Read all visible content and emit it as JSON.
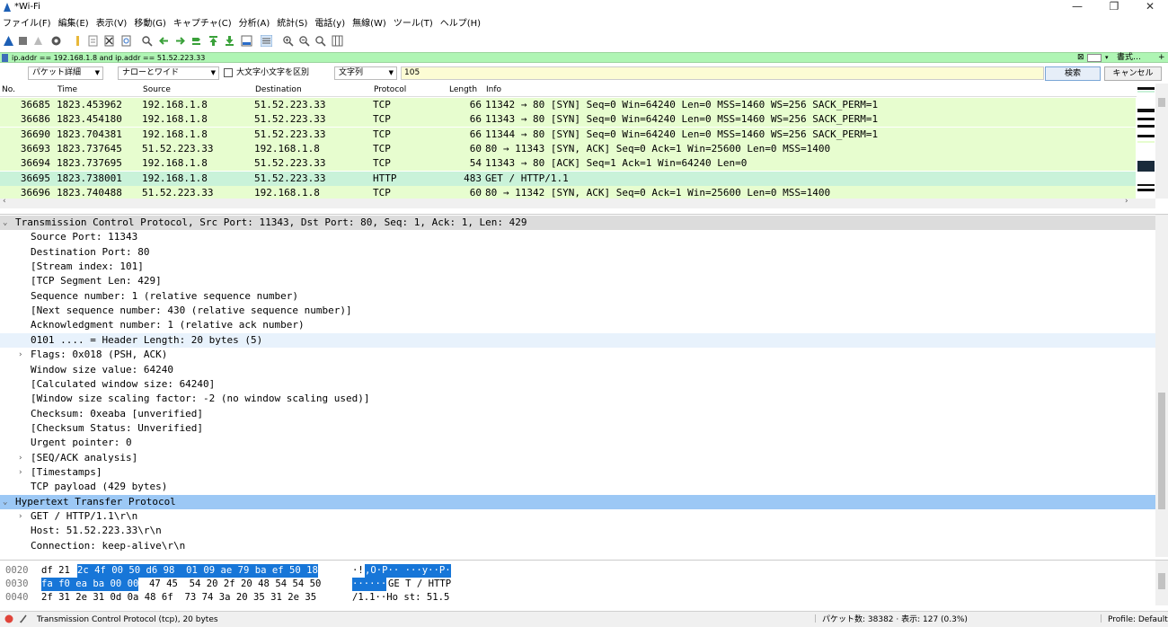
{
  "window": {
    "title": "*Wi-Fi"
  },
  "menu": [
    "ファイル(F)",
    "編集(E)",
    "表示(V)",
    "移動(G)",
    "キャプチャ(C)",
    "分析(A)",
    "統計(S)",
    "電話(y)",
    "無線(W)",
    "ツール(T)",
    "ヘルプ(H)"
  ],
  "filter": {
    "text": "ip.addr == 192.168.1.8 and ip.addr == 51.52.223.33",
    "expression_label": "書式…",
    "add_label": "+"
  },
  "search": {
    "scope": "パケット詳細",
    "width": "ナローとワイド",
    "case_label": "大文字小文字を区別",
    "type": "文字列",
    "value": "105",
    "find_label": "検索",
    "cancel_label": "キャンセル"
  },
  "packet_list": {
    "columns": [
      "No.",
      "Time",
      "Source",
      "Destination",
      "Protocol",
      "Length",
      "Info"
    ],
    "rows": [
      {
        "no": "36685",
        "time": "1823.453962",
        "src": "192.168.1.8",
        "dst": "51.52.223.33",
        "proto": "TCP",
        "len": "66",
        "info": "11342 → 80 [SYN] Seq=0 Win=64240 Len=0 MSS=1460 WS=256 SACK_PERM=1"
      },
      {
        "no": "36686",
        "time": "1823.454180",
        "src": "192.168.1.8",
        "dst": "51.52.223.33",
        "proto": "TCP",
        "len": "66",
        "info": "11343 → 80 [SYN] Seq=0 Win=64240 Len=0 MSS=1460 WS=256 SACK_PERM=1"
      },
      {
        "no": "36690",
        "time": "1823.704381",
        "src": "192.168.1.8",
        "dst": "51.52.223.33",
        "proto": "TCP",
        "len": "66",
        "info": "11344 → 80 [SYN] Seq=0 Win=64240 Len=0 MSS=1460 WS=256 SACK_PERM=1"
      },
      {
        "no": "36693",
        "time": "1823.737645",
        "src": "51.52.223.33",
        "dst": "192.168.1.8",
        "proto": "TCP",
        "len": "60",
        "info": "80 → 11343 [SYN, ACK] Seq=0 Ack=1 Win=25600 Len=0 MSS=1400"
      },
      {
        "no": "36694",
        "time": "1823.737695",
        "src": "192.168.1.8",
        "dst": "51.52.223.33",
        "proto": "TCP",
        "len": "54",
        "info": "11343 → 80 [ACK] Seq=1 Ack=1 Win=64240 Len=0"
      },
      {
        "no": "36695",
        "time": "1823.738001",
        "src": "192.168.1.8",
        "dst": "51.52.223.33",
        "proto": "HTTP",
        "len": "483",
        "info": "GET / HTTP/1.1"
      },
      {
        "no": "36696",
        "time": "1823.740488",
        "src": "51.52.223.33",
        "dst": "192.168.1.8",
        "proto": "TCP",
        "len": "60",
        "info": "80 → 11342 [SYN, ACK] Seq=0 Ack=1 Win=25600 Len=0 MSS=1400"
      }
    ]
  },
  "details": [
    {
      "text": "Transmission Control Protocol, Src Port: 11343, Dst Port: 80, Seq: 1, Ack: 1, Len: 429",
      "toggle": "v"
    },
    {
      "text": "Source Port: 11343",
      "toggle": ""
    },
    {
      "text": "Destination Port: 80",
      "toggle": ""
    },
    {
      "text": "[Stream index: 101]",
      "toggle": ""
    },
    {
      "text": "[TCP Segment Len: 429]",
      "toggle": ""
    },
    {
      "text": "Sequence number: 1    (relative sequence number)",
      "toggle": ""
    },
    {
      "text": "[Next sequence number: 430    (relative sequence number)]",
      "toggle": ""
    },
    {
      "text": "Acknowledgment number: 1    (relative ack number)",
      "toggle": ""
    },
    {
      "text": "0101 .... = Header Length: 20 bytes (5)",
      "toggle": ""
    },
    {
      "text": "Flags: 0x018 (PSH, ACK)",
      "toggle": ">"
    },
    {
      "text": "Window size value: 64240",
      "toggle": ""
    },
    {
      "text": "[Calculated window size: 64240]",
      "toggle": ""
    },
    {
      "text": "[Window size scaling factor: -2 (no window scaling used)]",
      "toggle": ""
    },
    {
      "text": "Checksum: 0xeaba [unverified]",
      "toggle": ""
    },
    {
      "text": "[Checksum Status: Unverified]",
      "toggle": ""
    },
    {
      "text": "Urgent pointer: 0",
      "toggle": ""
    },
    {
      "text": "[SEQ/ACK analysis]",
      "toggle": ">"
    },
    {
      "text": "[Timestamps]",
      "toggle": ">"
    },
    {
      "text": "TCP payload (429 bytes)",
      "toggle": ""
    },
    {
      "text": "Hypertext Transfer Protocol",
      "toggle": "v"
    },
    {
      "text": "GET / HTTP/1.1\\r\\n",
      "toggle": ">"
    },
    {
      "text": "Host: 51.52.223.33\\r\\n",
      "toggle": ""
    },
    {
      "text": "Connection: keep-alive\\r\\n",
      "toggle": ""
    }
  ],
  "bytes": [
    {
      "offset": "0020",
      "h1": "df 21",
      "h2": "2c 4f 00 50 d6 98  01 09 ae 79 ba ef 50 18",
      "h3": "",
      "a1": "·!",
      "a2": ",O·P·· ···y··P·",
      "a3": ""
    },
    {
      "offset": "0030",
      "h1": "",
      "h2": "fa f0 ea ba 00 00",
      "h3": "47 45  54 20 2f 20 48 54 54 50",
      "a1": "",
      "a2": "······",
      "a3": "GE T / HTTP"
    },
    {
      "offset": "0040",
      "h1": "2f 31 2e 31 0d 0a 48 6f  73 74 3a 20 35 31 2e 35",
      "h2": "",
      "h3": "",
      "a1": "/1.1··Ho st: 51.5",
      "a2": "",
      "a3": ""
    }
  ],
  "status": {
    "field": "Transmission Control Protocol (tcp), 20 bytes",
    "packets": "パケット数: 38382 · 表示: 127 (0.3%)",
    "profile": "Profile: Default"
  },
  "colors": {
    "filter_bg": "#aff5b4",
    "tcp_row": "#e7fdcf",
    "http_row": "#c9f2d9",
    "selected_detail": "#9cc8f5",
    "byte_highlight": "#1776d8"
  }
}
